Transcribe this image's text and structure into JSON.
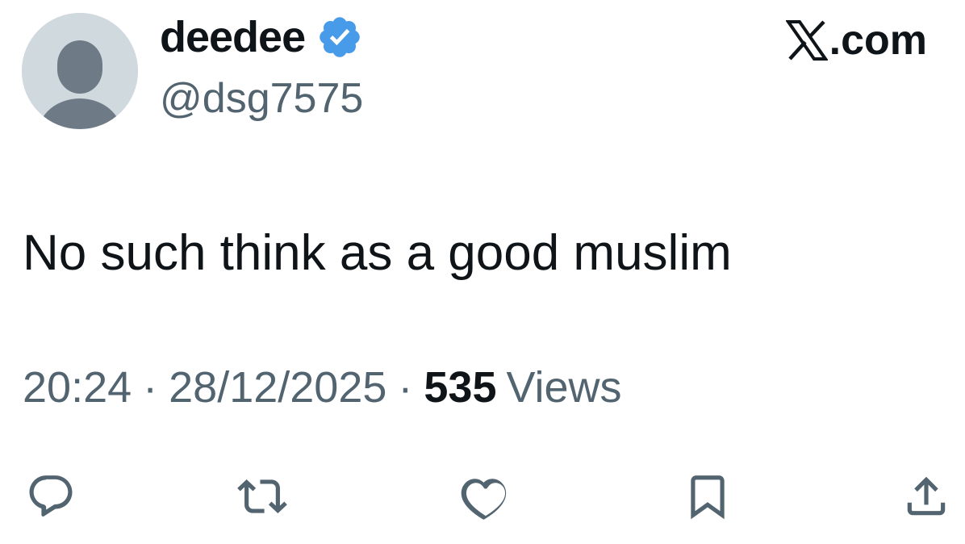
{
  "author": {
    "display_name": "deedee",
    "handle": "@dsg7575",
    "verified": true,
    "verified_color": "#489BE9",
    "avatar": "default-avatar"
  },
  "brand": {
    "label": ".com",
    "icon": "x-logo-icon"
  },
  "tweet": {
    "text": "No such think as a good muslim"
  },
  "meta": {
    "time": "20:24",
    "separator": "·",
    "date": "28/12/2025",
    "views_count": "535",
    "views_label": "Views"
  },
  "actions": [
    {
      "name": "reply",
      "icon": "reply-icon"
    },
    {
      "name": "retweet",
      "icon": "retweet-icon"
    },
    {
      "name": "like",
      "icon": "heart-icon"
    },
    {
      "name": "bookmark",
      "icon": "bookmark-icon"
    },
    {
      "name": "share",
      "icon": "share-icon"
    }
  ],
  "colors": {
    "text_primary": "#0F1419",
    "text_secondary": "#536471",
    "avatar_bg": "#CFD9DE",
    "avatar_figure": "#6E7B87"
  }
}
